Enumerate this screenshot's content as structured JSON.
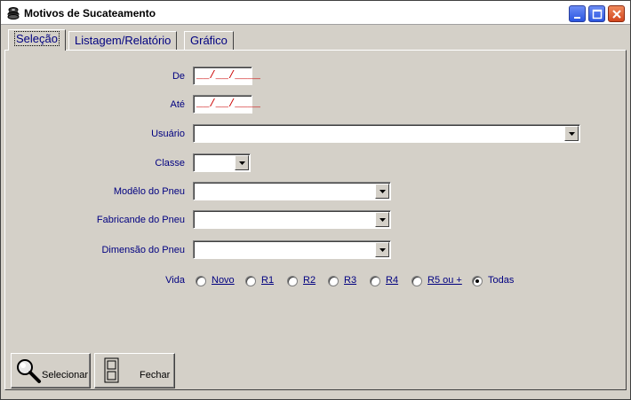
{
  "window": {
    "title": "Motivos de Sucateamento"
  },
  "tabs": [
    {
      "label": "Seleção",
      "active": true
    },
    {
      "label": "Listagem/Relatório",
      "active": false
    },
    {
      "label": "Gráfico",
      "active": false
    }
  ],
  "form": {
    "de_label": "De",
    "de_value": "__/__/____",
    "ate_label": "Até",
    "ate_value": "__/__/____",
    "usuario_label": "Usuário",
    "usuario_value": "",
    "classe_label": "Classe",
    "classe_value": "",
    "modelo_label": "Modêlo do Pneu",
    "modelo_value": "",
    "fabricante_label": "Fabricande do Pneu",
    "fabricante_value": "",
    "dimensao_label": "Dimensão do Pneu",
    "dimensao_value": "",
    "vida_label": "Vida",
    "vida_options": [
      "Novo",
      "R1",
      "R2",
      "R3",
      "R4",
      "R5 ou +",
      "Todas"
    ],
    "vida_selected": "Todas"
  },
  "buttons": {
    "selecionar": "Selecionar",
    "fechar": "Fechar"
  },
  "colors": {
    "label_blue": "#000080",
    "date_red": "#cc0000",
    "face": "#d4d0c8"
  }
}
